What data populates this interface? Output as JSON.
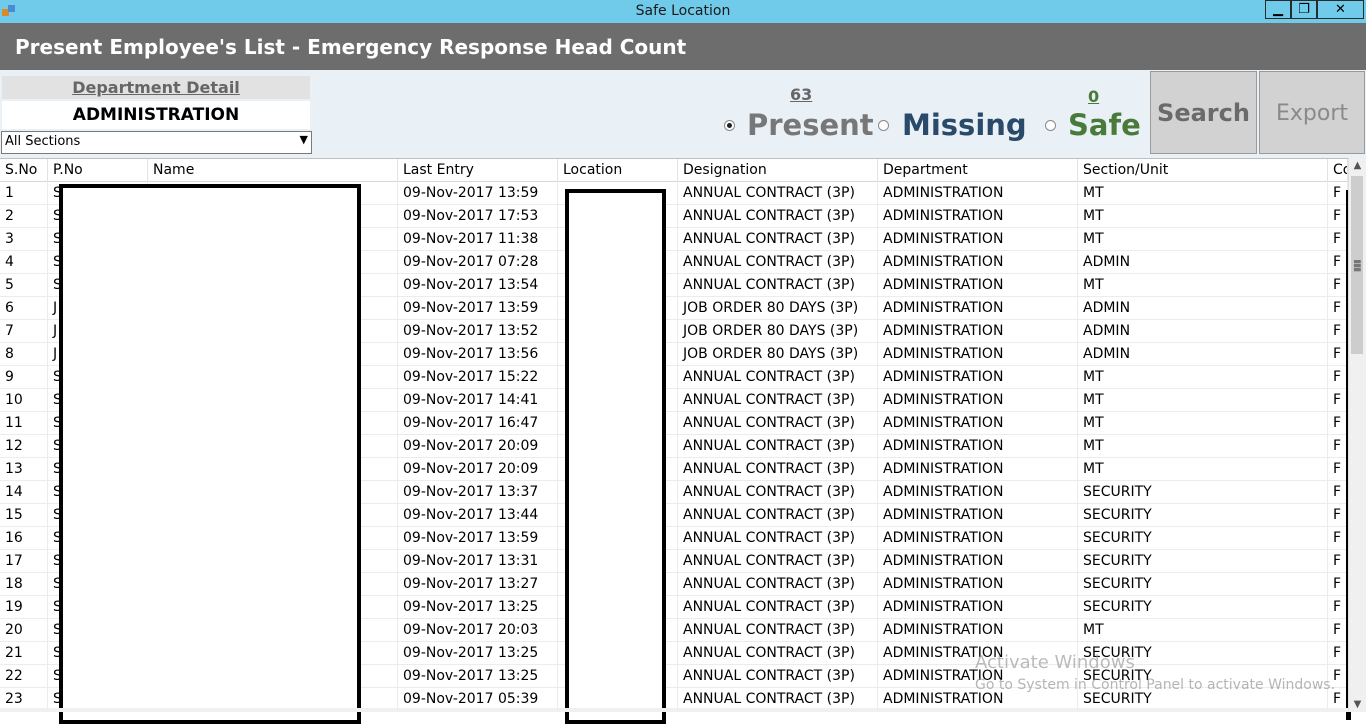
{
  "window": {
    "title": "Safe Location",
    "controls": {
      "minimize": "▁",
      "maximize": "❐",
      "close": "✕"
    }
  },
  "header": {
    "title": "Present Employee's List - Emergency Response Head Count"
  },
  "department": {
    "label": "Department Detail",
    "name": "ADMINISTRATION",
    "section_selected": "All Sections"
  },
  "status": {
    "present_count": "63",
    "safe_count": "0",
    "present_label": "Present",
    "missing_label": "Missing",
    "safe_label": "Safe",
    "selected": "present"
  },
  "buttons": {
    "search": "Search",
    "export": "Export"
  },
  "table": {
    "columns": [
      "S.No",
      "P.No",
      "Name",
      "Last Entry",
      "Location",
      "Designation",
      "Department",
      "Section/Unit",
      "Co"
    ],
    "rows": [
      {
        "sno": "1",
        "pno": "S",
        "entry": "09-Nov-2017 13:59",
        "desig": "ANNUAL CONTRACT (3P)",
        "dept": "ADMINISTRATION",
        "sec": "MT",
        "co": "F"
      },
      {
        "sno": "2",
        "pno": "S",
        "entry": "09-Nov-2017 17:53",
        "desig": "ANNUAL CONTRACT (3P)",
        "dept": "ADMINISTRATION",
        "sec": "MT",
        "co": "F"
      },
      {
        "sno": "3",
        "pno": "S",
        "entry": "09-Nov-2017 11:38",
        "desig": "ANNUAL CONTRACT (3P)",
        "dept": "ADMINISTRATION",
        "sec": "MT",
        "co": "F"
      },
      {
        "sno": "4",
        "pno": "S",
        "entry": "09-Nov-2017 07:28",
        "desig": "ANNUAL CONTRACT (3P)",
        "dept": "ADMINISTRATION",
        "sec": "ADMIN",
        "co": "F"
      },
      {
        "sno": "5",
        "pno": "S",
        "entry": "09-Nov-2017 13:54",
        "desig": "ANNUAL CONTRACT (3P)",
        "dept": "ADMINISTRATION",
        "sec": "MT",
        "co": "F"
      },
      {
        "sno": "6",
        "pno": "J",
        "entry": "09-Nov-2017 13:59",
        "desig": "JOB ORDER 80 DAYS (3P)",
        "dept": "ADMINISTRATION",
        "sec": "ADMIN",
        "co": "F"
      },
      {
        "sno": "7",
        "pno": "J",
        "entry": "09-Nov-2017 13:52",
        "desig": "JOB ORDER 80 DAYS (3P)",
        "dept": "ADMINISTRATION",
        "sec": "ADMIN",
        "co": "F"
      },
      {
        "sno": "8",
        "pno": "J",
        "entry": "09-Nov-2017 13:56",
        "desig": "JOB ORDER 80 DAYS (3P)",
        "dept": "ADMINISTRATION",
        "sec": "ADMIN",
        "co": "F"
      },
      {
        "sno": "9",
        "pno": "S",
        "entry": "09-Nov-2017 15:22",
        "desig": "ANNUAL CONTRACT (3P)",
        "dept": "ADMINISTRATION",
        "sec": "MT",
        "co": "F"
      },
      {
        "sno": "10",
        "pno": "S",
        "entry": "09-Nov-2017 14:41",
        "desig": "ANNUAL CONTRACT (3P)",
        "dept": "ADMINISTRATION",
        "sec": "MT",
        "co": "F"
      },
      {
        "sno": "11",
        "pno": "S",
        "entry": "09-Nov-2017 16:47",
        "desig": "ANNUAL CONTRACT (3P)",
        "dept": "ADMINISTRATION",
        "sec": "MT",
        "co": "F"
      },
      {
        "sno": "12",
        "pno": "S",
        "entry": "09-Nov-2017 20:09",
        "desig": "ANNUAL CONTRACT (3P)",
        "dept": "ADMINISTRATION",
        "sec": "MT",
        "co": "F"
      },
      {
        "sno": "13",
        "pno": "S",
        "entry": "09-Nov-2017 20:09",
        "desig": "ANNUAL CONTRACT (3P)",
        "dept": "ADMINISTRATION",
        "sec": "MT",
        "co": "F"
      },
      {
        "sno": "14",
        "pno": "S",
        "entry": "09-Nov-2017 13:37",
        "desig": "ANNUAL CONTRACT (3P)",
        "dept": "ADMINISTRATION",
        "sec": "SECURITY",
        "co": "F"
      },
      {
        "sno": "15",
        "pno": "S",
        "entry": "09-Nov-2017 13:44",
        "desig": "ANNUAL CONTRACT (3P)",
        "dept": "ADMINISTRATION",
        "sec": "SECURITY",
        "co": "F"
      },
      {
        "sno": "16",
        "pno": "S",
        "entry": "09-Nov-2017 13:59",
        "desig": "ANNUAL CONTRACT (3P)",
        "dept": "ADMINISTRATION",
        "sec": "SECURITY",
        "co": "F"
      },
      {
        "sno": "17",
        "pno": "S",
        "entry": "09-Nov-2017 13:31",
        "desig": "ANNUAL CONTRACT (3P)",
        "dept": "ADMINISTRATION",
        "sec": "SECURITY",
        "co": "F"
      },
      {
        "sno": "18",
        "pno": "S",
        "entry": "09-Nov-2017 13:27",
        "desig": "ANNUAL CONTRACT (3P)",
        "dept": "ADMINISTRATION",
        "sec": "SECURITY",
        "co": "F"
      },
      {
        "sno": "19",
        "pno": "S",
        "entry": "09-Nov-2017 13:25",
        "desig": "ANNUAL CONTRACT (3P)",
        "dept": "ADMINISTRATION",
        "sec": "SECURITY",
        "co": "F"
      },
      {
        "sno": "20",
        "pno": "S",
        "entry": "09-Nov-2017 20:03",
        "desig": "ANNUAL CONTRACT (3P)",
        "dept": "ADMINISTRATION",
        "sec": "MT",
        "co": "F"
      },
      {
        "sno": "21",
        "pno": "S",
        "entry": "09-Nov-2017 13:25",
        "desig": "ANNUAL CONTRACT (3P)",
        "dept": "ADMINISTRATION",
        "sec": "SECURITY",
        "co": "F"
      },
      {
        "sno": "22",
        "pno": "S",
        "entry": "09-Nov-2017 13:25",
        "desig": "ANNUAL CONTRACT (3P)",
        "dept": "ADMINISTRATION",
        "sec": "SECURITY",
        "co": "F"
      },
      {
        "sno": "23",
        "pno": "S",
        "entry": "09-Nov-2017 05:39",
        "desig": "ANNUAL CONTRACT (3P)",
        "dept": "ADMINISTRATION",
        "sec": "SECURITY",
        "co": "F"
      }
    ]
  },
  "watermark": {
    "line1": "Activate Windows",
    "line2": "Go to System in Control Panel to activate Windows."
  },
  "icons": {
    "app": "app-icon",
    "dropdown": "chevron-down-icon",
    "scroll_up": "arrow-up-icon",
    "scroll_down": "arrow-down-icon"
  }
}
